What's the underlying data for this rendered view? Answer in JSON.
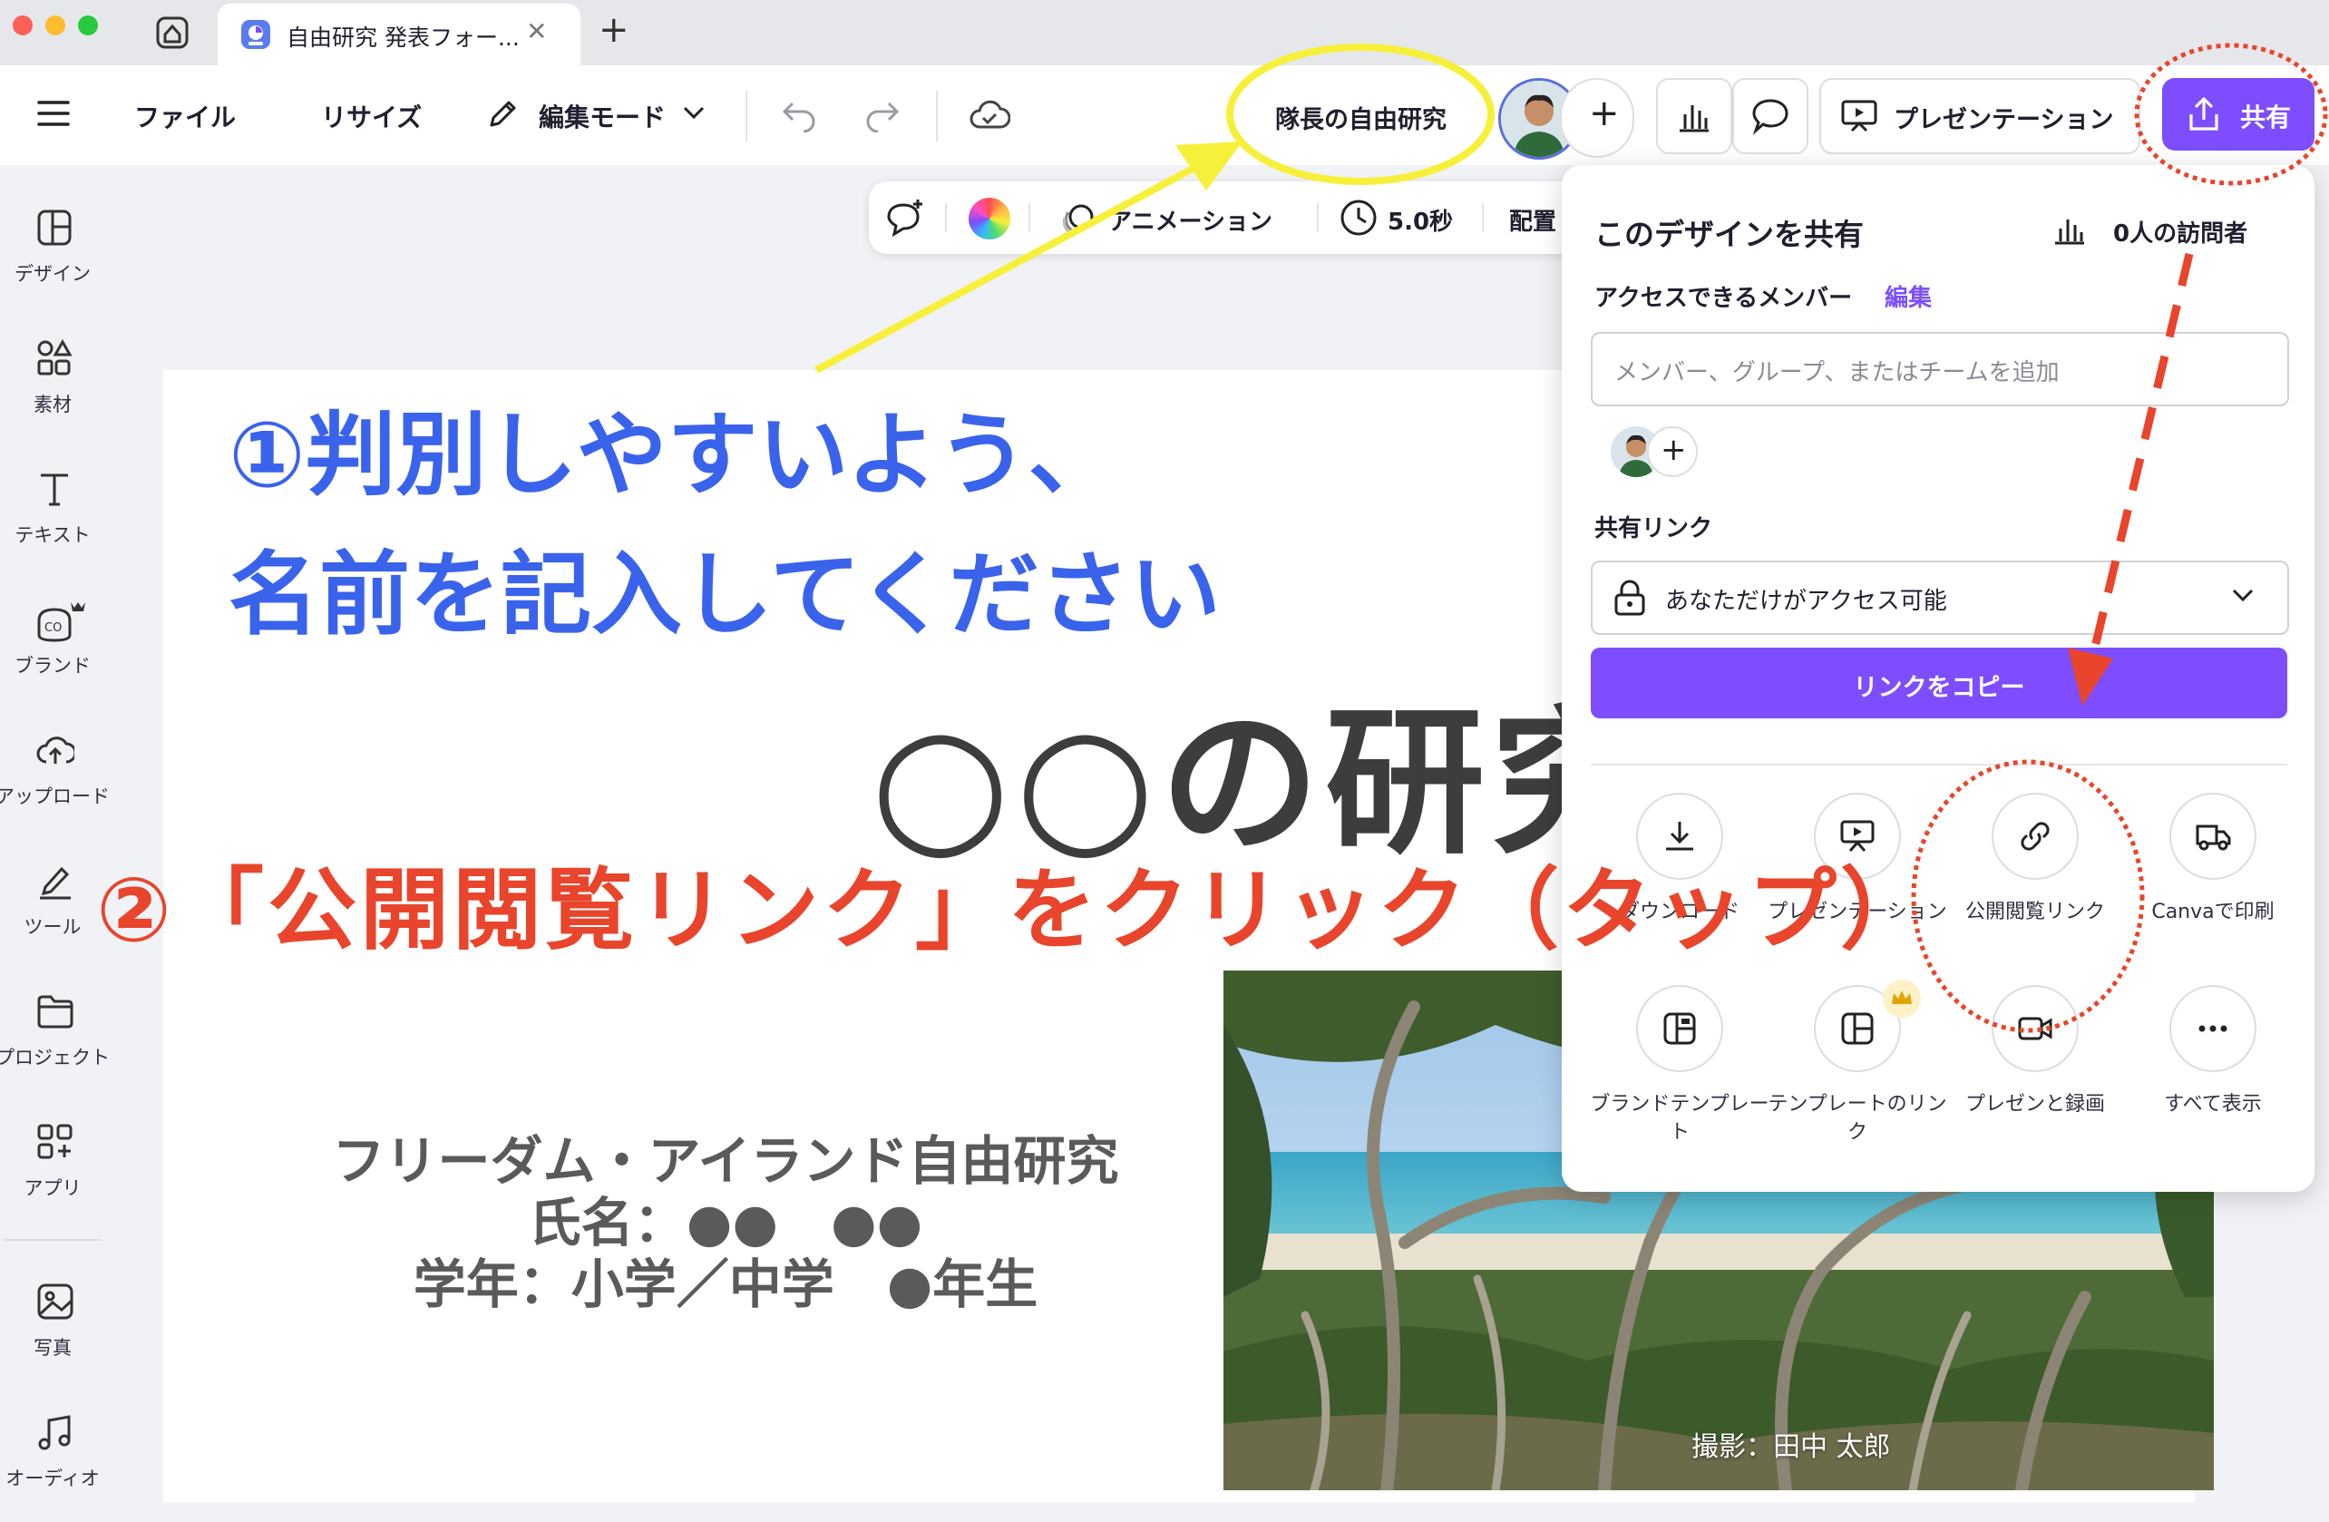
{
  "browser": {
    "tab_title": "自由研究 発表フォー...",
    "close_glyph": "✕",
    "new_tab_glyph": "+"
  },
  "toolbar": {
    "menu_icon": "hamburger-icon",
    "file": "ファイル",
    "resize": "リサイズ",
    "edit_mode": "編集モード",
    "design_name": "隊長の自由研究",
    "add_glyph": "+",
    "presentation": "プレゼンテーション",
    "share": "共有",
    "accent": "#7d4dff"
  },
  "floating_toolbar": {
    "animation": "アニメーション",
    "duration": "5.0秒",
    "position": "配置"
  },
  "sidebar": {
    "items": [
      {
        "label": "デザイン",
        "icon": "design-icon"
      },
      {
        "label": "素材",
        "icon": "elements-icon"
      },
      {
        "label": "テキスト",
        "icon": "text-icon"
      },
      {
        "label": "ブランド",
        "icon": "brand-icon"
      },
      {
        "label": "アップロード",
        "icon": "upload-icon"
      },
      {
        "label": "ツール",
        "icon": "tools-icon"
      },
      {
        "label": "プロジェクト",
        "icon": "folder-icon"
      },
      {
        "label": "アプリ",
        "icon": "apps-icon"
      },
      {
        "label": "写真",
        "icon": "photo-icon"
      },
      {
        "label": "オーディオ",
        "icon": "audio-icon"
      }
    ]
  },
  "slide": {
    "title": "○○の研究",
    "line1": "フリーダム・アイランド自由研究",
    "line2": "氏名：●●　●●",
    "line3": "学年：小学／中学　●年生",
    "photo_credit": "撮影：田中 太郎"
  },
  "annotations": {
    "step1_line1": "①判別しやすいよう、",
    "step1_line2": "名前を記入してください",
    "step2": "②「公開閲覧リンク」をクリック（タップ）",
    "step1_color": "#3a63ec",
    "step2_color": "#e8452c",
    "highlight_color": "#f6f03a"
  },
  "share_panel": {
    "title": "このデザインを共有",
    "visitors": "0人の訪問者",
    "members_label": "アクセスできるメンバー",
    "edit_link": "編集",
    "member_placeholder": "メンバー、グループ、またはチームを追加",
    "link_label": "共有リンク",
    "access_value": "あなただけがアクセス可能",
    "copy_button": "リンクをコピー",
    "options": [
      {
        "label": "ダウンロード",
        "icon": "download-icon"
      },
      {
        "label": "プレゼンテーション",
        "icon": "presentation-icon"
      },
      {
        "label": "公開閲覧リンク",
        "icon": "link-icon"
      },
      {
        "label": "Canvaで印刷",
        "icon": "truck-icon"
      },
      {
        "label": "ブランドテンプレート",
        "icon": "brand-template-icon"
      },
      {
        "label": "テンプレートのリンク",
        "icon": "template-icon"
      },
      {
        "label": "プレゼンと録画",
        "icon": "video-icon"
      },
      {
        "label": "すべて表示",
        "icon": "more-icon"
      }
    ]
  }
}
